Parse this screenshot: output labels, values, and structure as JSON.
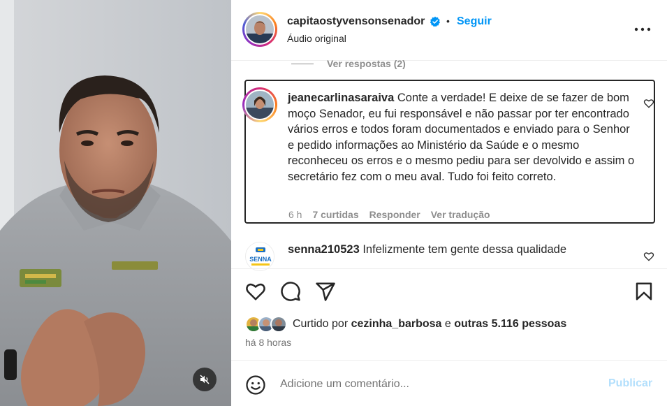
{
  "post": {
    "username": "capitaostyvensonsenador",
    "verified_icon": "verified-badge-icon",
    "separator": "•",
    "follow_label": "Seguir",
    "audio_label": "Áudio original",
    "more_icon": "more-options-icon"
  },
  "video": {
    "mute_icon": "muted-speaker-icon",
    "shirt_text": "PATRULHA"
  },
  "comments": {
    "view_replies": "Ver respostas (2)",
    "highlighted": {
      "username": "jeanecarlinasaraiva",
      "text": "Conte a verdade! E deixe de se fazer de bom moço Senador, eu fui responsável e não passar por ter encontrado vários erros e todos foram documentados e enviado para o Senhor e pedido informações ao Ministério da Saúde e o mesmo reconheceu os erros e o mesmo pediu para ser devolvido e assim o secretário fez com o meu aval. Tudo foi feito correto.",
      "time": "6 h",
      "likes": "7 curtidas",
      "reply_label": "Responder",
      "translate_label": "Ver tradução"
    },
    "next": {
      "username": "senna210523",
      "text": "Infelizmente tem gente dessa qualidade",
      "avatar_text": "SENNA"
    }
  },
  "actions": {
    "like_icon": "heart-icon",
    "comment_icon": "comment-icon",
    "share_icon": "share-icon",
    "save_icon": "bookmark-icon"
  },
  "likes": {
    "prefix": "Curtido por",
    "liked_by": "cezinha_barbosa",
    "connector": "e",
    "others": "outras 5.116 pessoas"
  },
  "time_ago": "há 8 horas",
  "comment_box": {
    "emoji_icon": "emoji-icon",
    "placeholder": "Adicione um comentário...",
    "post_label": "Publicar"
  },
  "colors": {
    "link_blue": "#0095f6",
    "publish_disabled": "#b2dffc",
    "text": "#262626",
    "muted": "#8e8e8e"
  }
}
